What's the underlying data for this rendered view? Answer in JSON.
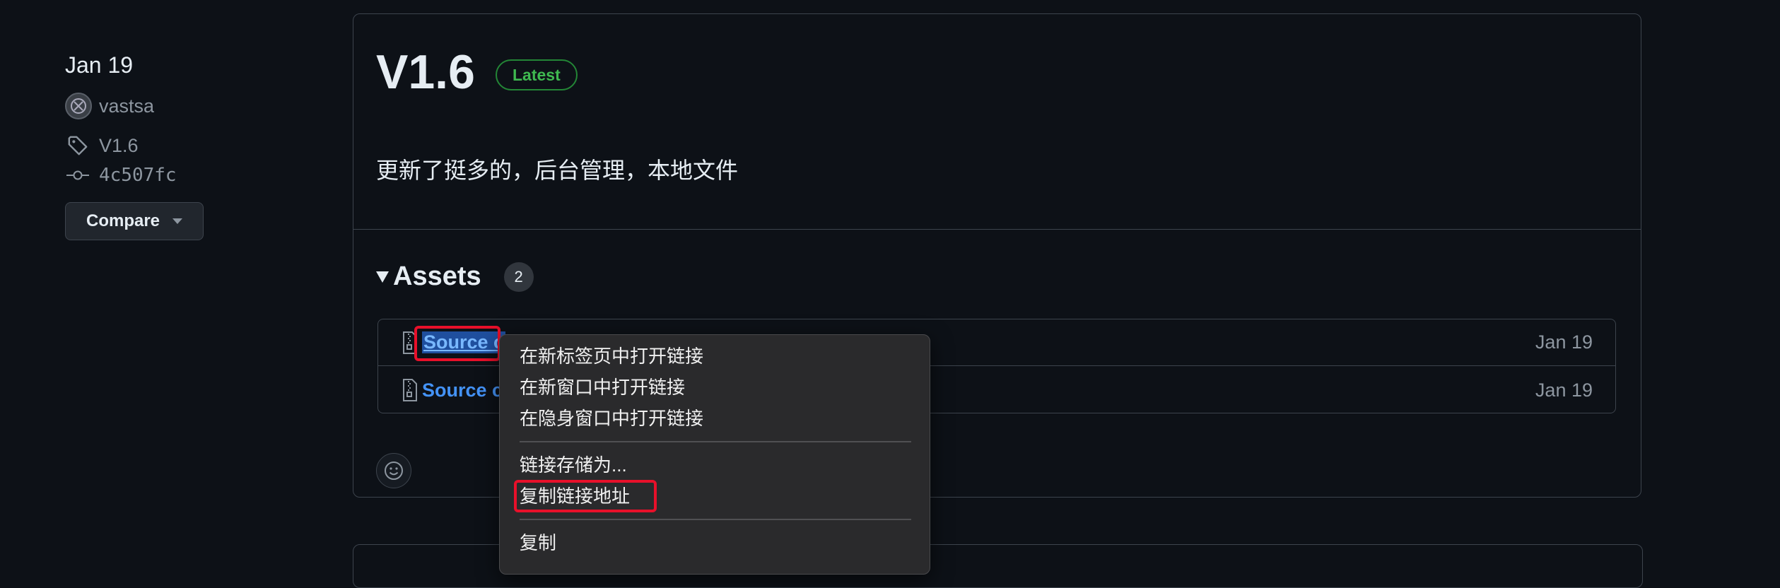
{
  "sidebar": {
    "date": "Jan 19",
    "author": "vastsa",
    "tag": "V1.6",
    "commit": "4c507fc",
    "compare_label": "Compare"
  },
  "release": {
    "title": "V1.6",
    "badge": "Latest",
    "body": "更新了挺多的，后台管理，本地文件"
  },
  "assets": {
    "title": "Assets",
    "count": "2",
    "rows": [
      {
        "name": "Source c",
        "date": "Jan 19"
      },
      {
        "name": "Source c",
        "date": "Jan 19"
      }
    ]
  },
  "context_menu": {
    "items": [
      "在新标签页中打开链接",
      "在新窗口中打开链接",
      "在隐身窗口中打开链接",
      "链接存储为...",
      "复制链接地址",
      "复制"
    ]
  },
  "colors": {
    "background": "#0d1117",
    "link": "#4493f8",
    "badge_green": "#3fb950",
    "highlight_red": "#e8102a"
  },
  "icons": [
    "avatar",
    "tag-icon",
    "commit-icon",
    "caret-down-icon",
    "zip-file-icon",
    "smiley-icon"
  ]
}
